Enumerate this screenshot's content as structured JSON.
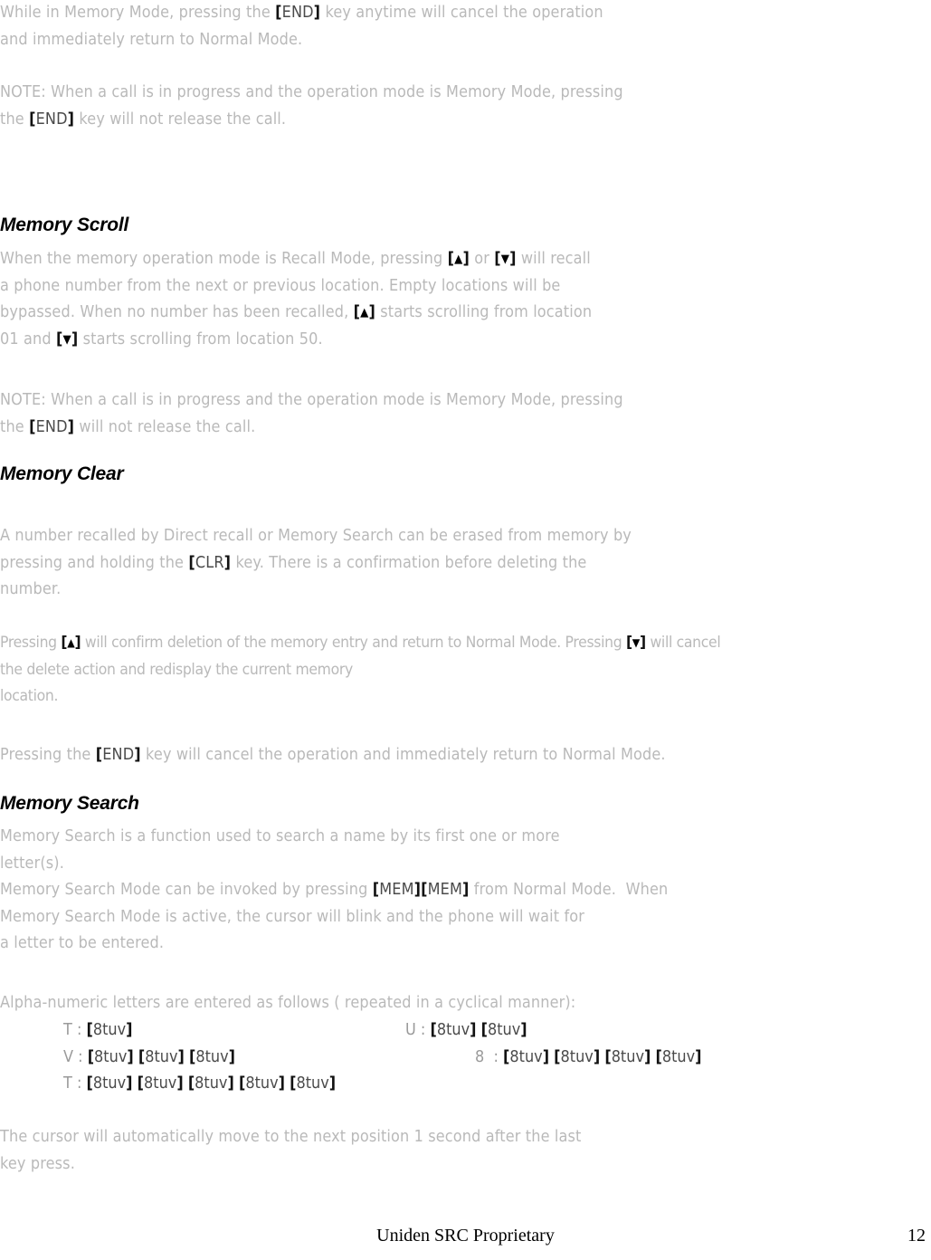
{
  "document": {
    "title": "Uniden SRC Proprietary",
    "page_number": "12",
    "body_text_color": "#b9b9b9",
    "heading_color": "#000000",
    "key_label_color": "#111111",
    "background_color": "#ffffff"
  },
  "intro": {
    "para1_line1_a": "While in Memory Mode, pressing the ",
    "para1_key": "[END]",
    "para1_line1_b": " key anytime will cancel the operation",
    "para1_line2": "and immediately return to Normal Mode.",
    "note_label": "NOTE:",
    "note_line1": " When a call is in progress and the operation mode is Memory Mode, pressing",
    "note_line2_a": "the ",
    "note_key": "[END]",
    "note_line2_b": " key will not release the call."
  },
  "memory_scroll": {
    "heading": "Memory Scroll",
    "line1_a": "When the memory operation mode is Recall Mode, pressing ",
    "key_up": "[▲]",
    "line1_b": " or ",
    "key_down": "[▼]",
    "line1_c": " will recall",
    "line2": "a phone number from the next or previous location. Empty locations will be",
    "line3_a": "bypassed. When no number has been recalled, ",
    "line3_key": "[▲]",
    "line3_b": " starts scrolling from location",
    "line4_a": "01 and ",
    "line4_key": "[▼]",
    "line4_b": " starts scrolling from location 50.",
    "note_label": "NOTE:",
    "note_line1": " When a call is in progress and the operation mode is Memory Mode, pressing",
    "note_line2_a": "the ",
    "note_key": "[END]",
    "note_line2_b": " will not release the call."
  },
  "memory_clear": {
    "heading": "Memory Clear",
    "p1_line1": "A number recalled by Direct recall or Memory Search can be erased from memory by",
    "p1_line2_a": "pressing and holding the ",
    "p1_key": "[CLR]",
    "p1_line2_b": " key. There is a confirmation before deleting the",
    "p1_line3": "number.",
    "p2_line1_a": "Pressing ",
    "p2_key_up": "[▲]",
    "p2_line1_b": " will confirm deletion of the memory entry and return to Normal Mode. Pressing ",
    "p2_key_down": "[▼]",
    "p2_line1_c": " will cancel",
    "p2_line2": "the delete action and redisplay the current memory",
    "p2_line3": "location.",
    "p3_line1_a": "Pressing the ",
    "p3_key": "[END]",
    "p3_line1_b": " key will cancel the operation and immediately return to Normal Mode."
  },
  "memory_search": {
    "heading": "Memory Search",
    "line1": "Memory Search is a function used to search a name by its first one or more",
    "line2": "letter(s).",
    "line3_a": "Memory Search Mode can be invoked by pressing ",
    "line3_key1": "[MEM]",
    "line3_key2": "[MEM]",
    "line3_b": " from Normal Mode.  When",
    "line4": "Memory Search Mode is active, the cursor will blink and the phone will wait for",
    "line5": "a letter to be entered.",
    "alpha_intro": "Alpha-numeric letters are entered as follows ( repeated in a cyclical manner):",
    "alpha_rows": [
      {
        "label": "T :",
        "keys": "[8tuv]",
        "column": "left"
      },
      {
        "label": "U :",
        "keys": "[8tuv] [8tuv]",
        "column": "right"
      },
      {
        "label": "V :",
        "keys": "[8tuv] [8tuv] [8tuv]",
        "column": "left"
      },
      {
        "label": "8  :",
        "keys": "[8tuv] [8tuv] [8tuv] [8tuv]",
        "column": "right"
      },
      {
        "label": "T :",
        "keys": "[8tuv] [8tuv] [8tuv] [8tuv] [8tuv]",
        "column": "left"
      }
    ],
    "closing_line1": "The cursor will automatically move to the next position 1 second after the last",
    "closing_line2": "key press."
  }
}
